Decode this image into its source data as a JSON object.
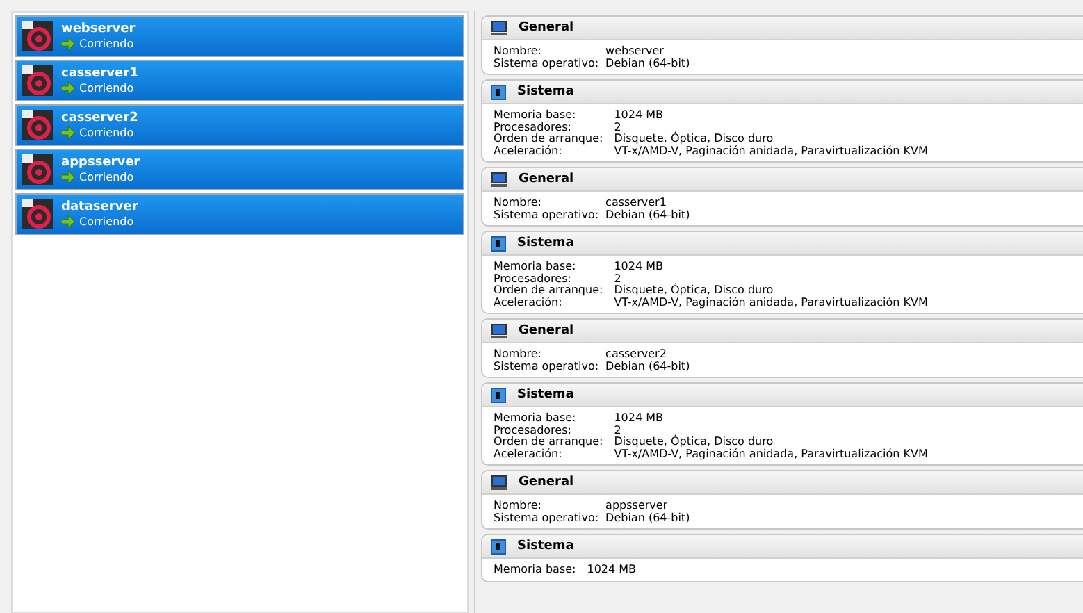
{
  "vms": [
    {
      "name": "webserver",
      "status": "Corriendo",
      "selected": true
    },
    {
      "name": "casserver1",
      "status": "Corriendo",
      "selected": true
    },
    {
      "name": "casserver2",
      "status": "Corriendo",
      "selected": true
    },
    {
      "name": "appsserver",
      "status": "Corriendo",
      "selected": true
    },
    {
      "name": "dataserver",
      "status": "Corriendo",
      "selected": true
    }
  ],
  "details": [
    {
      "kind": "general",
      "title": "General",
      "rows": [
        {
          "label": "Nombre:",
          "value": "webserver"
        },
        {
          "label": "Sistema operativo:",
          "value": "Debian (64-bit)"
        }
      ]
    },
    {
      "kind": "system",
      "title": "Sistema",
      "rows": [
        {
          "label": "Memoria base:",
          "value": "1024 MB"
        },
        {
          "label": "Procesadores:",
          "value": "2"
        },
        {
          "label": "Orden de arranque:",
          "value": "Disquete, Óptica, Disco duro"
        },
        {
          "label": "Aceleración:",
          "value": "VT-x/AMD-V, Paginación anidada, Paravirtualización KVM"
        }
      ]
    },
    {
      "kind": "general",
      "title": "General",
      "rows": [
        {
          "label": "Nombre:",
          "value": "casserver1"
        },
        {
          "label": "Sistema operativo:",
          "value": "Debian (64-bit)"
        }
      ]
    },
    {
      "kind": "system",
      "title": "Sistema",
      "rows": [
        {
          "label": "Memoria base:",
          "value": "1024 MB"
        },
        {
          "label": "Procesadores:",
          "value": "2"
        },
        {
          "label": "Orden de arranque:",
          "value": "Disquete, Óptica, Disco duro"
        },
        {
          "label": "Aceleración:",
          "value": "VT-x/AMD-V, Paginación anidada, Paravirtualización KVM"
        }
      ]
    },
    {
      "kind": "general",
      "title": "General",
      "rows": [
        {
          "label": "Nombre:",
          "value": "casserver2"
        },
        {
          "label": "Sistema operativo:",
          "value": "Debian (64-bit)"
        }
      ]
    },
    {
      "kind": "system",
      "title": "Sistema",
      "rows": [
        {
          "label": "Memoria base:",
          "value": "1024 MB"
        },
        {
          "label": "Procesadores:",
          "value": "2"
        },
        {
          "label": "Orden de arranque:",
          "value": "Disquete, Óptica, Disco duro"
        },
        {
          "label": "Aceleración:",
          "value": "VT-x/AMD-V, Paginación anidada, Paravirtualización KVM"
        }
      ]
    },
    {
      "kind": "general",
      "title": "General",
      "rows": [
        {
          "label": "Nombre:",
          "value": "appsserver"
        },
        {
          "label": "Sistema operativo:",
          "value": "Debian (64-bit)"
        }
      ]
    },
    {
      "kind": "system",
      "title": "Sistema",
      "rows": [
        {
          "label": "Memoria base:",
          "value": "1024 MB"
        }
      ]
    }
  ]
}
